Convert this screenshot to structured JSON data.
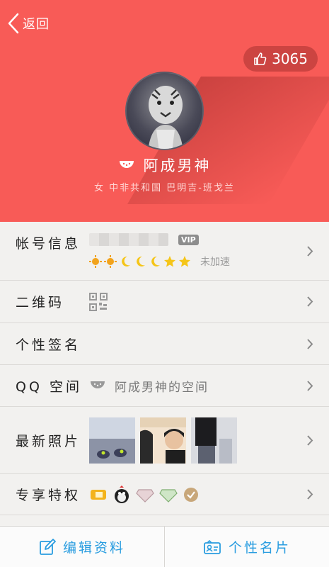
{
  "header": {
    "back_label": "返回",
    "likes": "3065",
    "nickname": "阿成男神",
    "location": "女 中非共和国 巴明吉-班戈兰"
  },
  "rows": {
    "account": {
      "label": "帐号信息",
      "vip": "VIP",
      "accel": "未加速"
    },
    "qrcode": {
      "label": "二维码"
    },
    "signature": {
      "label": "个性签名"
    },
    "qzone": {
      "label": "QQ 空间",
      "text": "阿成男神的空间"
    },
    "photos": {
      "label": "最新照片"
    },
    "privilege": {
      "label": "专享特权"
    }
  },
  "bottom": {
    "edit_label": "编辑资料",
    "card_label": "个性名片"
  },
  "colors": {
    "header_bg": "#f85b57",
    "accent_blue": "#2a9de0"
  }
}
